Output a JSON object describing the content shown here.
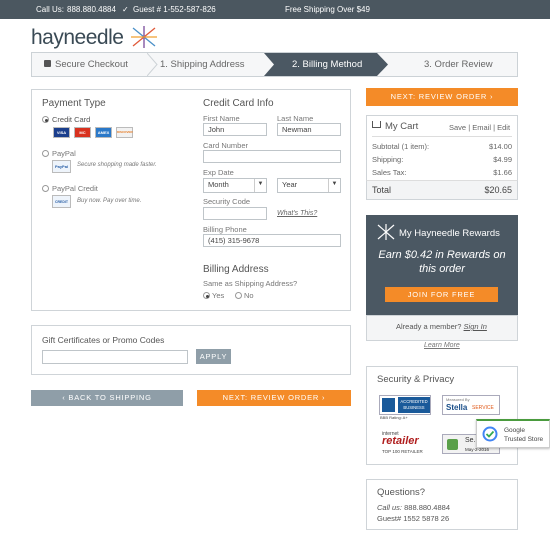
{
  "topbar": {
    "call": "Call Us:",
    "phone": "888.880.4884",
    "guest": "Guest # 1-552-587-826",
    "shipping": "Free Shipping Over $49"
  },
  "logo": "hayneedle",
  "steps": {
    "secure": "Secure Checkout",
    "s1": "1. Shipping Address",
    "s2": "2. Billing Method",
    "s3": "3. Order Review"
  },
  "payment": {
    "title": "Payment Type",
    "credit_card": "Credit Card",
    "paypal": "PayPal",
    "paypal_note": "Secure shopping made faster.",
    "paypal_credit": "PayPal Credit",
    "paypal_credit_note": "Buy now. Pay over time.",
    "card_logos": [
      "VISA",
      "MC",
      "AMEX",
      "DISCOVER"
    ],
    "paypal_logo": "PayPal",
    "paypal_credit_logo": "CREDIT"
  },
  "cc_info": {
    "title": "Credit Card Info",
    "first_name_label": "First Name",
    "first_name": "John",
    "last_name_label": "Last Name",
    "last_name": "Newman",
    "card_number_label": "Card Number",
    "card_number": "",
    "exp_label": "Exp Date",
    "month": "Month",
    "year": "Year",
    "security_label": "Security Code",
    "security_code": "",
    "whats_this": "What's This?",
    "phone_label": "Billing Phone",
    "phone": "(415) 315-9678"
  },
  "billing_address": {
    "title": "Billing Address",
    "question": "Same as Shipping Address?",
    "yes": "Yes",
    "no": "No"
  },
  "gift": {
    "title": "Gift Certificates or Promo Codes",
    "code": "",
    "apply": "APPLY"
  },
  "buttons": {
    "back": "‹  BACK TO SHIPPING",
    "next_bottom": "NEXT: REVIEW ORDER  ›",
    "next_top": "NEXT: REVIEW ORDER  ›"
  },
  "cart": {
    "title": "My Cart",
    "save": "Save",
    "email": "Email",
    "edit": "Edit",
    "subtotal_label": "Subtotal (1 item):",
    "subtotal": "$14.00",
    "shipping_label": "Shipping:",
    "shipping": "$4.99",
    "tax_label": "Sales Tax:",
    "tax": "$1.66",
    "total_label": "Total",
    "total": "$20.65"
  },
  "rewards": {
    "title": "My Hayneedle Rewards",
    "earn": "Earn $0.42 in Rewards on this order",
    "join": "JOIN FOR FREE",
    "member": "Already a member?",
    "sign_in": "Sign In",
    "learn_more": "Learn More"
  },
  "security": {
    "title": "Security & Privacy",
    "bbb_line1": "ACCREDITED",
    "bbb_line2": "BUSINESS",
    "bbb_rating": "BBB Rating: A+",
    "stella_top": "Measured By",
    "stella_brand": "Stella",
    "stella_service": "SERVICE",
    "retailer_top": "internet",
    "retailer_brand": "retailer",
    "retailer_sub": "TOP 100 RETAILER",
    "secured_text": "Se...",
    "secured_date": "May-2-2016",
    "google_line1": "Google",
    "google_line2": "Trusted Store"
  },
  "questions": {
    "title": "Questions?",
    "call_label": "Call us:",
    "phone": "888.880.4884",
    "guest": "Guest# 1552 5878 26"
  },
  "colors": {
    "dark": "#4b5863",
    "orange": "#f48b28",
    "gray_button": "#8f9ea8",
    "link": "#2a6ab8"
  }
}
